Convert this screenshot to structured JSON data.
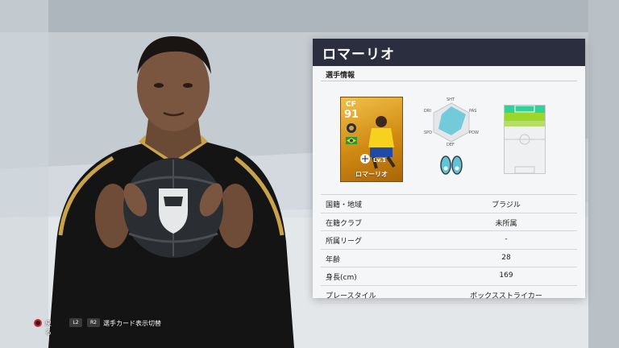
{
  "header": {
    "player_name": "ロマーリオ"
  },
  "section": {
    "title": "選手情報"
  },
  "card": {
    "position": "CF",
    "overall": "91",
    "level": "Lv.1",
    "name": "ロマーリオ",
    "colors": {
      "gold": "#e6a623",
      "badge_bg": "#2b2e3e"
    }
  },
  "hexagon": {
    "labels": [
      "SHT",
      "PAS",
      "POW",
      "DEF",
      "SPD",
      "DRI"
    ],
    "accent_color": "#5fc4d6"
  },
  "positions_map": {
    "highlight_colors": [
      "#2fd39a",
      "#9bd62a"
    ]
  },
  "info": {
    "rows": [
      {
        "label": "国籍・地域",
        "value": "ブラジル"
      },
      {
        "label": "在籍クラブ",
        "value": "未所属"
      },
      {
        "label": "所属リーグ",
        "value": "-"
      },
      {
        "label": "年齢",
        "value": "28"
      },
      {
        "label": "身長(cm)",
        "value": "169"
      },
      {
        "label": "プレースタイル",
        "value": "ボックスストライカー"
      }
    ]
  },
  "footer": {
    "back_label": "戻る",
    "l2_label": "L2",
    "r2_label": "R2",
    "switch_label": "選手カード表示切替"
  }
}
